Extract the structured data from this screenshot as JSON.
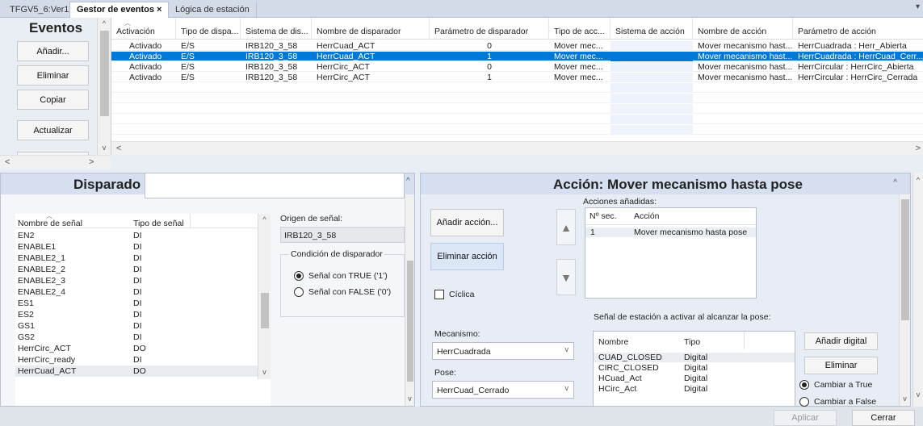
{
  "tabs": [
    {
      "label": "TFGV5_6:Ver1"
    },
    {
      "label": "Gestor de eventos",
      "close": "×"
    },
    {
      "label": "Lógica de estación"
    }
  ],
  "tab_menu_icon": "dropdown-arrow",
  "events": {
    "title": "Eventos",
    "add_label": "Añadir...",
    "delete_label": "Eliminar",
    "copy_label": "Copiar",
    "refresh_label": "Actualizar"
  },
  "grid": {
    "columns": [
      "Activación",
      "Tipo de dispa...",
      "Sistema de dis...",
      "Nombre de disparador",
      "Parámetro de disparador",
      "Tipo de acc...",
      "Sistema de acción",
      "Nombre de acción",
      "Parámetro de acción"
    ],
    "rows": [
      [
        "Activado",
        "E/S",
        "IRB120_3_58",
        "HerrCuad_ACT",
        "0",
        "Mover mec...",
        "",
        "Mover mecanismo hast...",
        "HerrCuadrada : Herr_Abierta"
      ],
      [
        "Activado",
        "E/S",
        "IRB120_3_58",
        "HerrCuad_ACT",
        "1",
        "Mover mec...",
        "",
        "Mover mecanismo hast...",
        "HerrCuadrada : HerrCuad_Cerr..."
      ],
      [
        "Activado",
        "E/S",
        "IRB120_3_58",
        "HerrCirc_ACT",
        "0",
        "Mover mec...",
        "",
        "Mover mecanismo hast...",
        "HerrCircular : HerrCirc_Abierta"
      ],
      [
        "Activado",
        "E/S",
        "IRB120_3_58",
        "HerrCirc_ACT",
        "1",
        "Mover mec...",
        "",
        "Mover mecanismo hast...",
        "HerrCircular : HerrCirc_Cerrada"
      ]
    ],
    "selected_row": 1
  },
  "trigger": {
    "title": "Disparado",
    "signal_name_header": "Nombre de señal",
    "signal_type_header": "Tipo de señal",
    "signals": [
      [
        "EN2",
        "DI"
      ],
      [
        "ENABLE1",
        "DI"
      ],
      [
        "ENABLE2_1",
        "DI"
      ],
      [
        "ENABLE2_2",
        "DI"
      ],
      [
        "ENABLE2_3",
        "DI"
      ],
      [
        "ENABLE2_4",
        "DI"
      ],
      [
        "ES1",
        "DI"
      ],
      [
        "ES2",
        "DI"
      ],
      [
        "GS1",
        "DI"
      ],
      [
        "GS2",
        "DI"
      ],
      [
        "HerrCirc_ACT",
        "DO"
      ],
      [
        "HerrCirc_ready",
        "DI"
      ],
      [
        "HerrCuad_ACT",
        "DO"
      ]
    ],
    "selected_signal": 12,
    "origin_label": "Origen de señal:",
    "origin_value": "IRB120_3_58",
    "condition_title": "Condición de disparador",
    "radio_true": "Señal con TRUE ('1')",
    "radio_false": "Señal con FALSE ('0')",
    "condition_selected": "true"
  },
  "action": {
    "title": "Acción: Mover mecanismo hasta pose",
    "added_label": "Acciones añadidas:",
    "add_action": "Añadir acción...",
    "remove_action": "Eliminar acción",
    "cyclic": "Cíclica",
    "cyclic_checked": false,
    "seq_header": "Nº sec.",
    "action_header": "Acción",
    "actions": [
      [
        "1",
        "Mover mecanismo hasta pose"
      ]
    ],
    "station_signal_label": "Señal de estación a activar al alcanzar la pose:",
    "mechanism_label": "Mecanismo:",
    "mechanism_value": "HerrCuadrada",
    "pose_label": "Pose:",
    "pose_value": "HerrCuad_Cerrado",
    "sig_name_header": "Nombre",
    "sig_type_header": "Tipo",
    "station_signals": [
      [
        "CUAD_CLOSED",
        "Digital"
      ],
      [
        "CIRC_CLOSED",
        "Digital"
      ],
      [
        "HCuad_Act",
        "Digital"
      ],
      [
        "HCirc_Act",
        "Digital"
      ]
    ],
    "add_digital": "Añadir digital",
    "delete": "Eliminar",
    "set_true": "Cambiar a True",
    "set_false": "Cambiar a False",
    "set_selected": "true"
  },
  "footer": {
    "apply": "Aplicar",
    "close": "Cerrar"
  }
}
